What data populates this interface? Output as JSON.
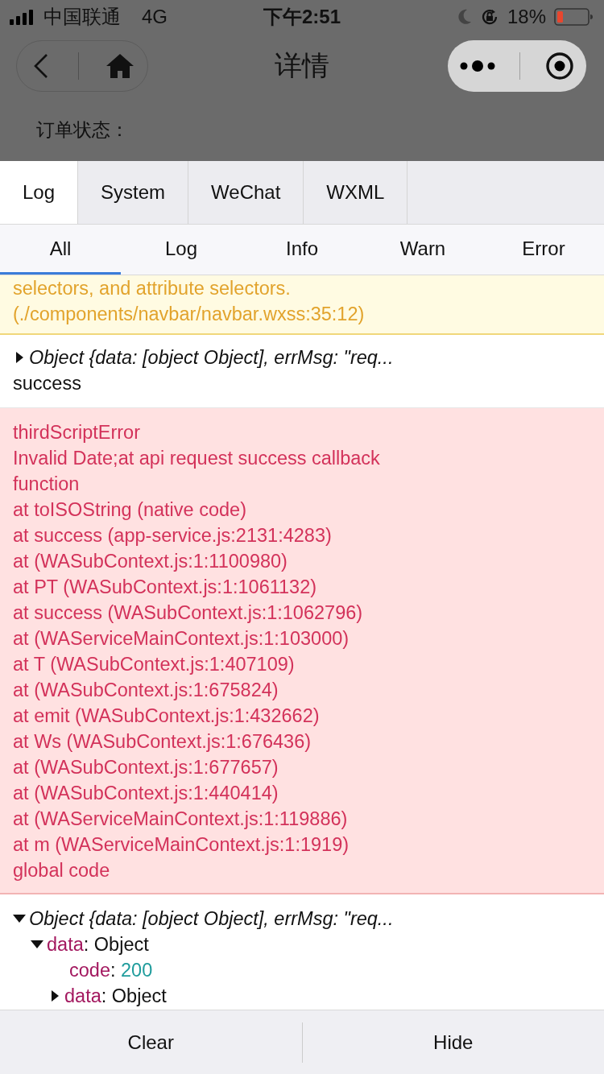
{
  "status_bar": {
    "carrier": "中国联通",
    "network": "4G",
    "time": "下午2:51",
    "battery_text": "18%"
  },
  "nav": {
    "title": "详情"
  },
  "page": {
    "fields": [
      "订单状态："
    ]
  },
  "console": {
    "tabs": [
      {
        "label": "Log",
        "selected": true
      },
      {
        "label": "System",
        "selected": false
      },
      {
        "label": "WeChat",
        "selected": false
      },
      {
        "label": "WXML",
        "selected": false
      }
    ],
    "filters": [
      {
        "label": "All",
        "selected": true
      },
      {
        "label": "Log",
        "selected": false
      },
      {
        "label": "Info",
        "selected": false
      },
      {
        "label": "Warn",
        "selected": false
      },
      {
        "label": "Error",
        "selected": false
      }
    ],
    "entries": [
      {
        "kind": "warn",
        "lines": [
          "selectors, and attribute selectors.",
          "(./components/navbar/navbar.wxss:35:12)"
        ]
      },
      {
        "kind": "log",
        "object": {
          "summary": "Object {data: [object Object], errMsg: \"req...",
          "expanded": false
        },
        "lines": [
          "success"
        ]
      },
      {
        "kind": "error",
        "lines": [
          "thirdScriptError",
          "Invalid Date;at api request success callback",
          "function",
          "at toISOString (native code)",
          "at success (app-service.js:2131:4283)",
          "at (WASubContext.js:1:1100980)",
          "at PT (WASubContext.js:1:1061132)",
          "at success (WASubContext.js:1:1062796)",
          "at (WAServiceMainContext.js:1:103000)",
          "at T (WASubContext.js:1:407109)",
          "at (WASubContext.js:1:675824)",
          "at emit (WASubContext.js:1:432662)",
          "at Ws (WASubContext.js:1:676436)",
          "at (WASubContext.js:1:677657)",
          "at (WASubContext.js:1:440414)",
          "at (WAServiceMainContext.js:1:119886)",
          "at m (WAServiceMainContext.js:1:1919)",
          "global code"
        ]
      },
      {
        "kind": "tree",
        "object": {
          "summary": "Object {data: [object Object], errMsg: \"req...",
          "expanded": true,
          "children": [
            {
              "key": "data",
              "separator": ":",
              "value": "Object",
              "kind": "object",
              "expanded": true,
              "children": [
                {
                  "key": "code",
                  "separator": ":",
                  "value": "200",
                  "kind": "number"
                },
                {
                  "key": "data",
                  "separator": ":",
                  "value": "Object",
                  "kind": "object",
                  "expanded": false
                }
              ]
            }
          ]
        }
      }
    ],
    "buttons": [
      {
        "label": "Clear"
      },
      {
        "label": "Hide"
      }
    ]
  }
}
